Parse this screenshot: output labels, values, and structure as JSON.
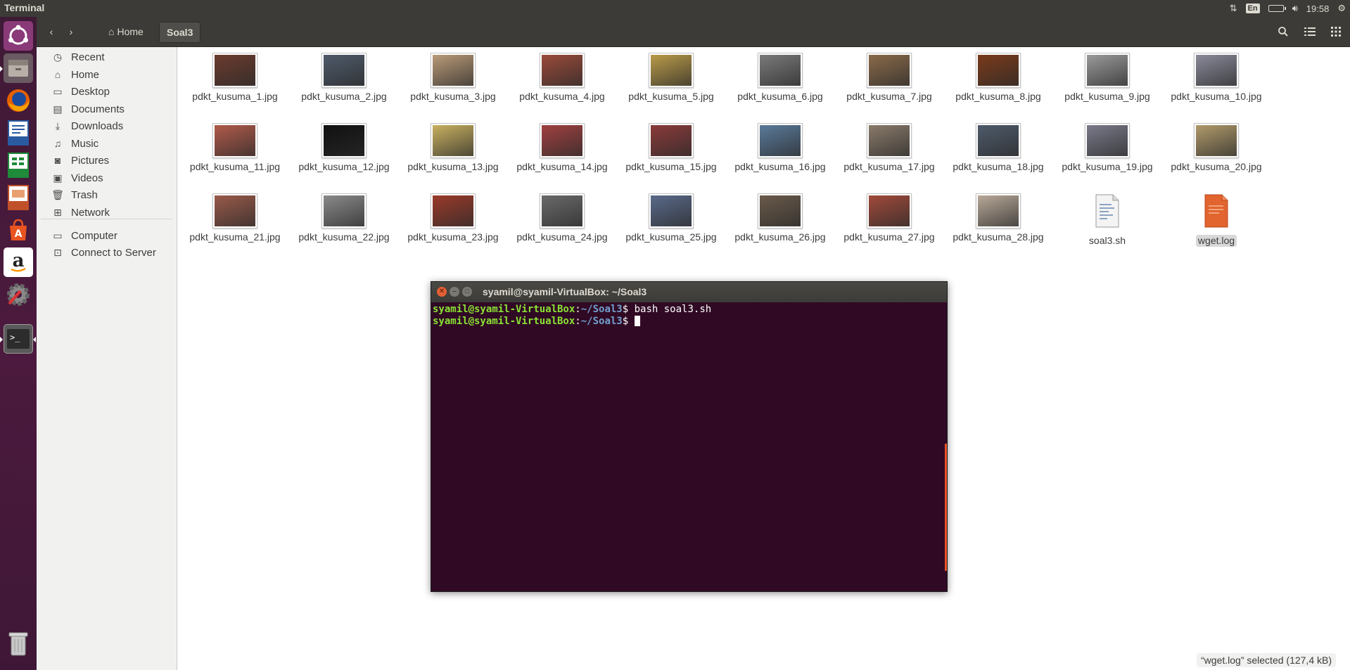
{
  "top_panel": {
    "app_title": "Terminal",
    "lang_indicator": "En",
    "clock": "19:58"
  },
  "launcher": {
    "items": [
      {
        "name": "ubuntu-dash-icon"
      },
      {
        "name": "files-icon"
      },
      {
        "name": "firefox-icon"
      },
      {
        "name": "libreoffice-writer-icon"
      },
      {
        "name": "libreoffice-calc-icon"
      },
      {
        "name": "libreoffice-impress-icon"
      },
      {
        "name": "ubuntu-software-icon"
      },
      {
        "name": "amazon-icon"
      },
      {
        "name": "system-settings-icon"
      },
      {
        "name": "terminal-icon"
      },
      {
        "name": "trash-icon"
      }
    ]
  },
  "header": {
    "breadcrumb_home": "Home",
    "breadcrumb_current": "Soal3"
  },
  "sidebar": {
    "items": [
      {
        "label": "Recent",
        "icon": "clock-icon"
      },
      {
        "label": "Home",
        "icon": "home-icon"
      },
      {
        "label": "Desktop",
        "icon": "folder-icon"
      },
      {
        "label": "Documents",
        "icon": "document-icon"
      },
      {
        "label": "Downloads",
        "icon": "download-icon"
      },
      {
        "label": "Music",
        "icon": "music-icon"
      },
      {
        "label": "Pictures",
        "icon": "camera-icon"
      },
      {
        "label": "Videos",
        "icon": "video-icon"
      },
      {
        "label": "Trash",
        "icon": "trash-icon"
      },
      {
        "label": "Network",
        "icon": "network-icon"
      },
      {
        "label": "Computer",
        "icon": "computer-icon"
      },
      {
        "label": "Connect to Server",
        "icon": "server-icon"
      }
    ]
  },
  "files": [
    {
      "name": "pdkt_kusuma_1.jpg",
      "color": "#6b3b2e"
    },
    {
      "name": "pdkt_kusuma_2.jpg",
      "color": "#4e5a6a"
    },
    {
      "name": "pdkt_kusuma_3.jpg",
      "color": "#b99a78"
    },
    {
      "name": "pdkt_kusuma_4.jpg",
      "color": "#9a4a3a"
    },
    {
      "name": "pdkt_kusuma_5.jpg",
      "color": "#b89a48"
    },
    {
      "name": "pdkt_kusuma_6.jpg",
      "color": "#7a7a7a"
    },
    {
      "name": "pdkt_kusuma_7.jpg",
      "color": "#8a6a4a"
    },
    {
      "name": "pdkt_kusuma_8.jpg",
      "color": "#7a3a1a"
    },
    {
      "name": "pdkt_kusuma_9.jpg",
      "color": "#9a9a9a"
    },
    {
      "name": "pdkt_kusuma_10.jpg",
      "color": "#8a8a9a"
    },
    {
      "name": "pdkt_kusuma_11.jpg",
      "color": "#b05a4a"
    },
    {
      "name": "pdkt_kusuma_12.jpg",
      "color": "#111111"
    },
    {
      "name": "pdkt_kusuma_13.jpg",
      "color": "#c8b060"
    },
    {
      "name": "pdkt_kusuma_14.jpg",
      "color": "#a04040"
    },
    {
      "name": "pdkt_kusuma_15.jpg",
      "color": "#8a3a3a"
    },
    {
      "name": "pdkt_kusuma_16.jpg",
      "color": "#5a7a9a"
    },
    {
      "name": "pdkt_kusuma_17.jpg",
      "color": "#8a7a6a"
    },
    {
      "name": "pdkt_kusuma_18.jpg",
      "color": "#4e5a6a"
    },
    {
      "name": "pdkt_kusuma_19.jpg",
      "color": "#7a7a8a"
    },
    {
      "name": "pdkt_kusuma_20.jpg",
      "color": "#b09a6a"
    },
    {
      "name": "pdkt_kusuma_21.jpg",
      "color": "#9a5a4a"
    },
    {
      "name": "pdkt_kusuma_22.jpg",
      "color": "#8a8a8a"
    },
    {
      "name": "pdkt_kusuma_23.jpg",
      "color": "#9a3a2a"
    },
    {
      "name": "pdkt_kusuma_24.jpg",
      "color": "#6a6a6a"
    },
    {
      "name": "pdkt_kusuma_25.jpg",
      "color": "#5a6a8a"
    },
    {
      "name": "pdkt_kusuma_26.jpg",
      "color": "#6a5a4a"
    },
    {
      "name": "pdkt_kusuma_27.jpg",
      "color": "#a04a3a"
    },
    {
      "name": "pdkt_kusuma_28.jpg",
      "color": "#b8a898"
    },
    {
      "name": "soal3.sh",
      "type": "script"
    },
    {
      "name": "wget.log",
      "type": "log",
      "selected": true
    }
  ],
  "status": "“wget.log” selected (127,4 kB)",
  "terminal": {
    "title": "syamil@syamil-VirtualBox: ~/Soal3",
    "prompt_user": "syamil@syamil-VirtualBox",
    "prompt_path": "~/Soal3",
    "lines": [
      {
        "command": "bash soal3.sh"
      },
      {
        "command": ""
      }
    ]
  },
  "colors": {
    "panel": "#3c3b37",
    "launcher": "#4c1a3e",
    "terminal_bg": "#300a24",
    "prompt_user": "#8ae234",
    "prompt_path": "#729fcf",
    "accent": "#e9542a"
  }
}
